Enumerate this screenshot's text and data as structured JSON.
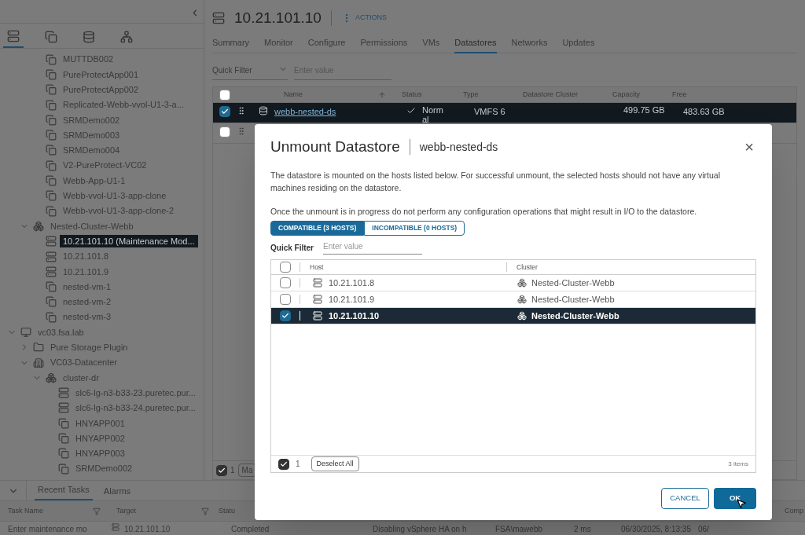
{
  "sidebar": {
    "collapse": "‹",
    "icon_tabs": [
      {
        "kind": "hosts",
        "selected": true
      },
      {
        "kind": "vms",
        "selected": false
      },
      {
        "kind": "storage",
        "selected": false
      },
      {
        "kind": "network",
        "selected": false
      }
    ],
    "tree": [
      {
        "children": [
          {
            "children": [
              {
                "label": "MUTTDB002",
                "kind": "vm",
                "selected": false
              },
              {
                "label": "PureProtectApp001",
                "kind": "vm",
                "selected": false
              },
              {
                "label": "PureProtectApp002",
                "kind": "vm",
                "selected": false
              },
              {
                "label": "Replicated-Webb-vvol-U1-3-a...",
                "kind": "vm",
                "selected": false
              },
              {
                "label": "SRMDemo002",
                "kind": "vm",
                "selected": false
              },
              {
                "label": "SRMDemo003",
                "kind": "vm",
                "selected": false
              },
              {
                "label": "SRMDemo004",
                "kind": "vm",
                "selected": false
              },
              {
                "label": "V2-PureProtect-VC02",
                "kind": "vm",
                "selected": false
              },
              {
                "label": "Webb-App-U1-1",
                "kind": "vm",
                "selected": false
              },
              {
                "label": "Webb-vvol-U1-3-app-clone",
                "kind": "vm",
                "selected": false
              },
              {
                "label": "Webb-vvol-U1-3-app-clone-2",
                "kind": "vm",
                "selected": false
              }
            ]
          },
          {
            "label": "Nested-Cluster-Webb",
            "kind": "cluster",
            "expanded": true,
            "selected": false,
            "children": [
              {
                "label": "10.21.101.10 (Maintenance Mod...",
                "kind": "host",
                "selected": true
              },
              {
                "label": "10.21.101.8",
                "kind": "host",
                "selected": false
              },
              {
                "label": "10.21.101.9",
                "kind": "host",
                "selected": false
              },
              {
                "label": "nested-vm-1",
                "kind": "vm",
                "selected": false
              },
              {
                "label": "nested-vm-2",
                "kind": "vm",
                "selected": false
              },
              {
                "label": "nested-vm-3",
                "kind": "vm",
                "selected": false
              }
            ]
          }
        ]
      },
      {
        "label": "vc03.fsa.lab",
        "kind": "vcenter",
        "expanded": true,
        "selected": false,
        "children": [
          {
            "label": "Pure Storage Plugin",
            "kind": "folder",
            "expanded": false,
            "selected": false
          },
          {
            "label": "VC03-Datacenter",
            "kind": "datacenter",
            "expanded": true,
            "selected": false,
            "children": [
              {
                "label": "cluster-dr",
                "kind": "cluster",
                "expanded": true,
                "selected": false,
                "children": [
                  {
                    "label": "slc6-lg-n3-b33-23.puretec.pur...",
                    "kind": "server",
                    "selected": false
                  },
                  {
                    "label": "slc6-lg-n3-b33-24.puretec.pur...",
                    "kind": "server",
                    "selected": false
                  },
                  {
                    "label": "HNYAPP001",
                    "kind": "vm",
                    "selected": false
                  },
                  {
                    "label": "HNYAPP002",
                    "kind": "vm",
                    "selected": false
                  },
                  {
                    "label": "HNYAPP003",
                    "kind": "vm",
                    "selected": false
                  },
                  {
                    "label": "SRMDemo002",
                    "kind": "vm",
                    "selected": false
                  }
                ]
              }
            ]
          }
        ]
      }
    ]
  },
  "host": {
    "title": "10.21.101.10",
    "actions": "ACTIONS",
    "tabs": [
      {
        "label": "Summary",
        "selected": false
      },
      {
        "label": "Monitor",
        "selected": false
      },
      {
        "label": "Configure",
        "selected": false
      },
      {
        "label": "Permissions",
        "selected": false
      },
      {
        "label": "VMs",
        "selected": false
      },
      {
        "label": "Datastores",
        "selected": true
      },
      {
        "label": "Networks",
        "selected": false
      },
      {
        "label": "Updates",
        "selected": false
      }
    ],
    "filter": {
      "label": "Quick Filter",
      "placeholder": "Enter value"
    },
    "table": {
      "columns": [
        "Name",
        "Status",
        "Type",
        "Datastore Cluster",
        "Capacity",
        "Free"
      ],
      "select_all_checked": false,
      "rows": [
        {
          "checked": true,
          "selected": true,
          "name": "webb-nested-ds",
          "status": "Normal",
          "type": "VMFS 6",
          "capacity": "499.75 GB",
          "free": "483.63 GB"
        },
        {
          "checked": false,
          "selected": false
        }
      ],
      "footer_checked": true,
      "footer_count": "1",
      "footer_button": "Ma"
    }
  },
  "dialog": {
    "title": "Unmount Datastore",
    "subtitle": "webb-nested-ds",
    "close": "×",
    "text": [
      "The datastore is mounted on the hosts listed below. For successful unmount, the selected hosts should not have any virtual machines residing on the datastore.",
      "Once the unmount is in progress do not perform any configuration operations that might result in I/O to the datastore."
    ],
    "tabs": [
      {
        "label": "COMPATIBLE (3 HOSTS)",
        "selected": true
      },
      {
        "label": "INCOMPATIBLE (0 HOSTS)",
        "selected": false
      }
    ],
    "filter": {
      "label": "Quick Filter",
      "placeholder": "Enter value"
    },
    "columns": [
      "Host",
      "Cluster"
    ],
    "select_all_checked": false,
    "rows": [
      {
        "host": "10.21.101.8",
        "cluster": "Nested-Cluster-Webb",
        "checked": false,
        "selected": false
      },
      {
        "host": "10.21.101.9",
        "cluster": "Nested-Cluster-Webb",
        "checked": false,
        "selected": false
      },
      {
        "host": "10.21.101.10",
        "cluster": "Nested-Cluster-Webb",
        "checked": true,
        "selected": true
      }
    ],
    "footer": {
      "checked": true,
      "count": "1",
      "deselect": "Deselect All",
      "items": "3 items"
    },
    "buttons": [
      {
        "label": "CANCEL",
        "kind": "secondary"
      },
      {
        "label": "OK",
        "kind": "primary"
      }
    ]
  },
  "tasks": {
    "tabs": [
      {
        "label": "Recent Tasks",
        "selected": true
      },
      {
        "label": "Alarms",
        "selected": false
      }
    ],
    "columns": [
      "Task Name",
      "Target",
      "Statu"
    ],
    "right_column": "Comp",
    "row": [
      "Enter maintenance mo",
      "10.21.101.10",
      "Completed",
      "Disabling vSphere HA on h",
      "FSA\\mawebb",
      "2 ms",
      "06/30/2025, 8:13:35",
      "06/"
    ]
  }
}
